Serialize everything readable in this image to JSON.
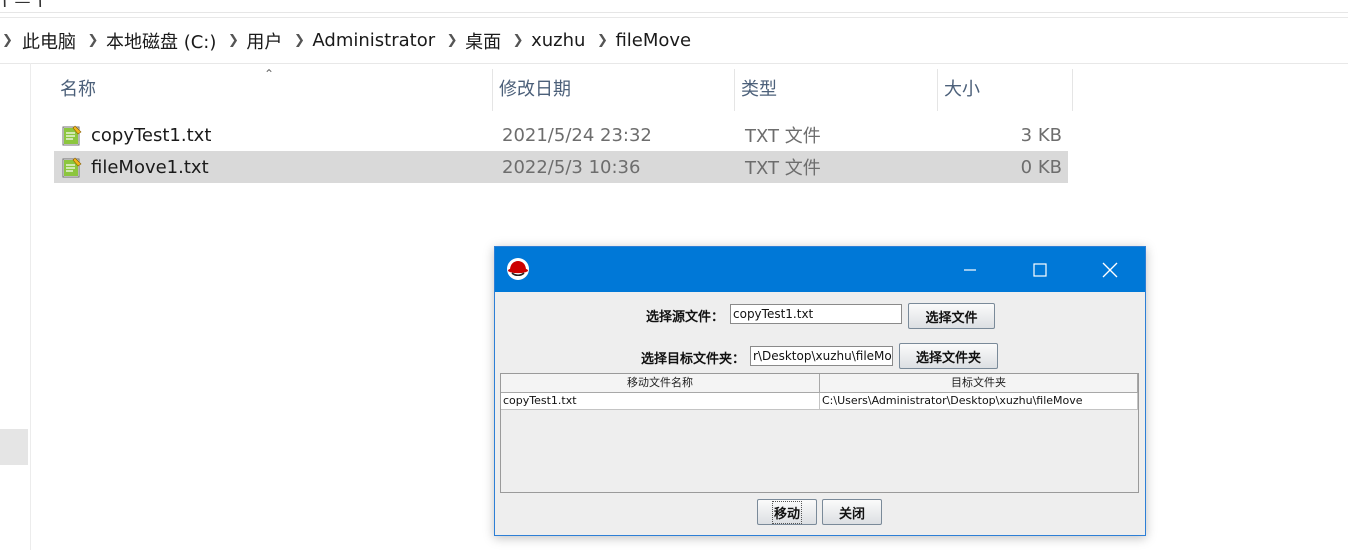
{
  "explorer": {
    "top_partial_text": "ٲ — ٲ",
    "breadcrumb": [
      "此电脑",
      "本地磁盘 (C:)",
      "用户",
      "Administrator",
      "桌面",
      "xuzhu",
      "fileMove"
    ],
    "columns": {
      "name": "名称",
      "date": "修改日期",
      "type": "类型",
      "size": "大小"
    },
    "files": [
      {
        "name": "copyTest1.txt",
        "date": "2021/5/24 23:32",
        "type": "TXT 文件",
        "size": "3 KB"
      },
      {
        "name": "fileMove1.txt",
        "date": "2022/5/3 10:36",
        "type": "TXT 文件",
        "size": "0 KB"
      }
    ]
  },
  "dialog": {
    "source_label": "选择源文件：",
    "source_value": "copyTest1.txt",
    "choose_file_button": "选择文件",
    "target_label": "选择目标文件夹：",
    "target_value": "r\\Desktop\\xuzhu\\fileMove",
    "choose_folder_button": "选择文件夹",
    "table": {
      "headers": [
        "移动文件名称",
        "目标文件夹"
      ],
      "rows": [
        [
          "copyTest1.txt",
          "C:\\Users\\Administrator\\Desktop\\xuzhu\\fileMove"
        ]
      ]
    },
    "move_button": "移动",
    "close_button": "关闭"
  },
  "colors": {
    "titlebar": "#0078d7",
    "selection": "#d9d9d9",
    "dialog_bg": "#eeeeee"
  }
}
